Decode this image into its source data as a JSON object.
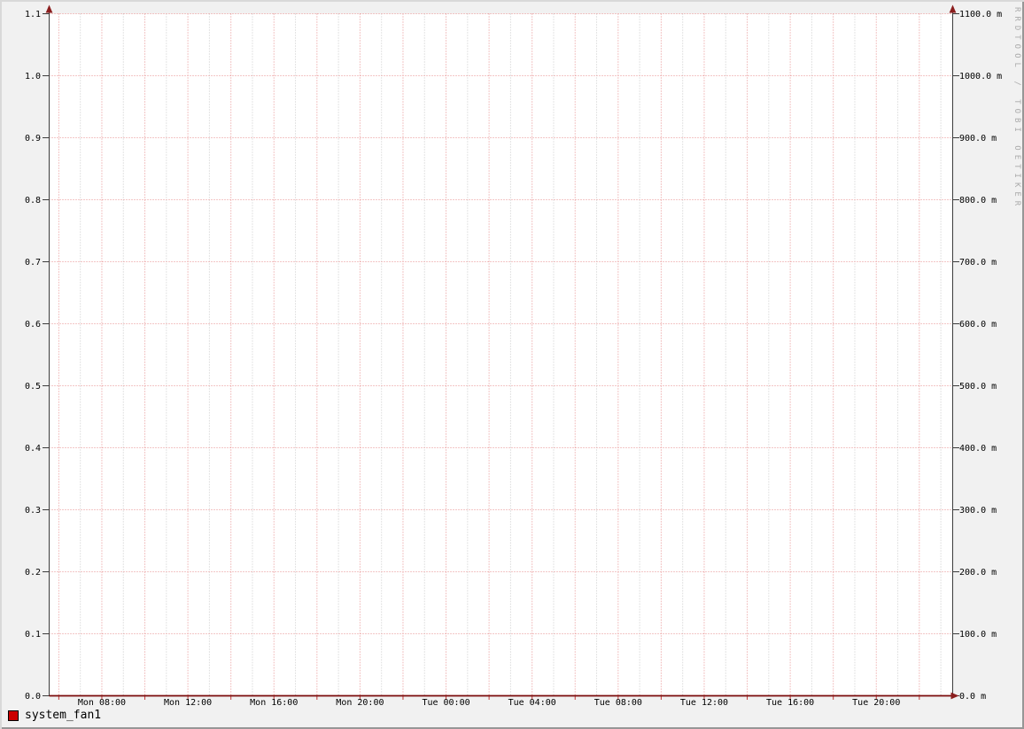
{
  "watermark": "RRDTOOL / TOBI OETIKER",
  "legend": {
    "items": [
      {
        "label": "system_fan1",
        "color": "#cc0000"
      }
    ]
  },
  "chart_data": {
    "type": "line",
    "title": "",
    "x_axis": {
      "tick_labels": [
        "Mon 08:00",
        "Mon 12:00",
        "Mon 16:00",
        "Mon 20:00",
        "Tue 00:00",
        "Tue 04:00",
        "Tue 08:00",
        "Tue 12:00",
        "Tue 16:00",
        "Tue 20:00"
      ],
      "minor_grid_interval_hours": 1,
      "major_grid_interval_hours": 2,
      "labeled_interval_hours": 4
    },
    "y_axis_left": {
      "min": 0.0,
      "max": 1.1,
      "tick_step": 0.1,
      "tick_labels_top_to_bottom": [
        "1.1",
        "1.0",
        "0.9",
        "0.8",
        "0.7",
        "0.6",
        "0.5",
        "0.4",
        "0.3",
        "0.2",
        "0.1",
        "0.0"
      ]
    },
    "y_axis_right": {
      "tick_labels_top_to_bottom": [
        "1100.0 m",
        "1000.0 m",
        "900.0 m",
        "800.0 m",
        "700.0 m",
        "600.0 m",
        "500.0 m",
        "400.0 m",
        "300.0 m",
        "200.0 m",
        "100.0 m",
        "0.0 m"
      ]
    },
    "series": [
      {
        "name": "system_fan1",
        "color": "#cc0000",
        "flat_value": 0,
        "values": [
          0,
          0
        ]
      }
    ],
    "grid": true,
    "legend_position": "bottom-left",
    "colors": {
      "background": "#f1f1f1",
      "canvas": "#ffffff",
      "major_grid": "#e78c8c",
      "minor_grid": "#c9c9c9",
      "axis": "#3c3c3c",
      "arrow": "#8b1e1e",
      "zero_line": "#7a0a0a",
      "x_tick_red": "#c23b3b",
      "text": "#000000",
      "watermark_text": "#ababab"
    }
  }
}
